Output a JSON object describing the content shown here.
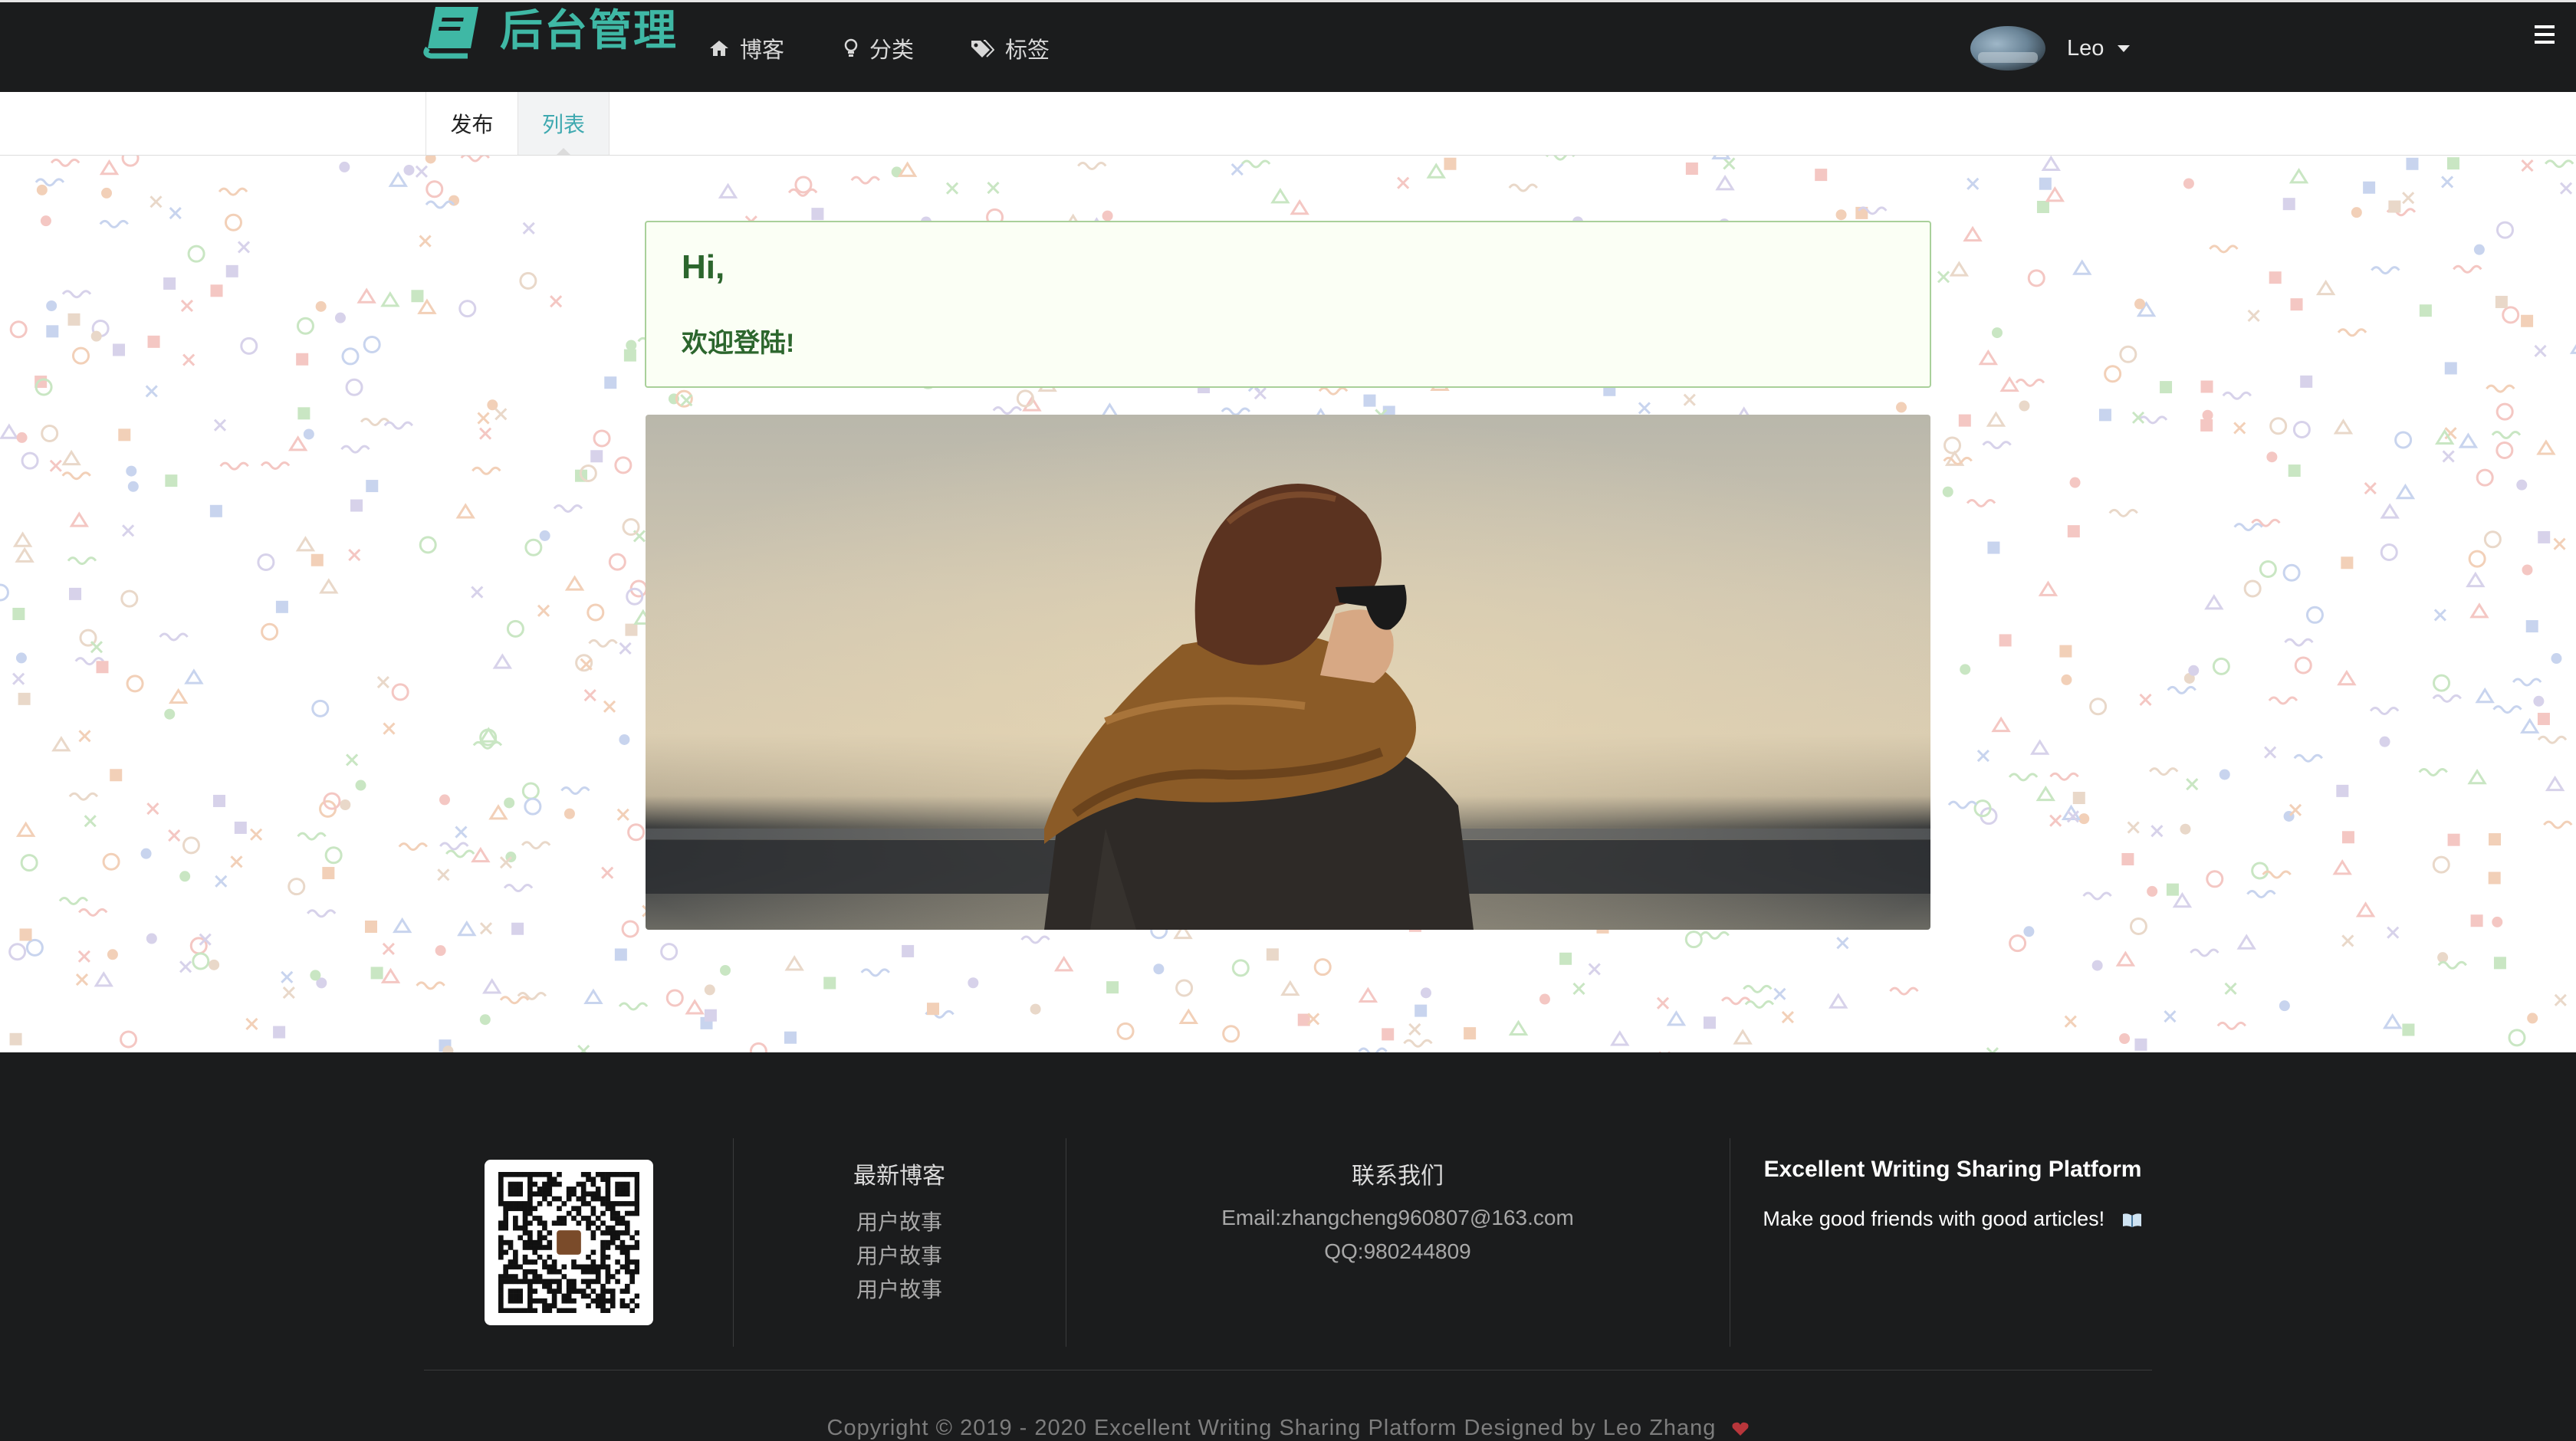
{
  "navbar": {
    "brand": "后台管理",
    "items": [
      {
        "label": "博客",
        "icon": "home-icon"
      },
      {
        "label": "分类",
        "icon": "lightbulb-icon"
      },
      {
        "label": "标签",
        "icon": "tags-icon"
      }
    ],
    "user": {
      "name": "Leo"
    },
    "menu_icon": "hamburger-icon",
    "brand_color": "#3fb8a5"
  },
  "tabs": [
    {
      "label": "发布",
      "active": false
    },
    {
      "label": "列表",
      "active": true
    }
  ],
  "welcome": {
    "greeting": "Hi,",
    "message": "欢迎登陆!"
  },
  "footer": {
    "recent_title": "最新博客",
    "recent_items": [
      "用户故事",
      "用户故事",
      "用户故事"
    ],
    "contact_title": "联系我们",
    "email": "Email:zhangcheng960807@163.com",
    "qq": "QQ:980244809",
    "site_title": "Excellent Writing Sharing Platform",
    "site_tagline": "Make good friends with good articles!",
    "copyright": "Copyright © 2019 - 2020 Excellent Writing Sharing Platform Designed by Leo Zhang"
  }
}
